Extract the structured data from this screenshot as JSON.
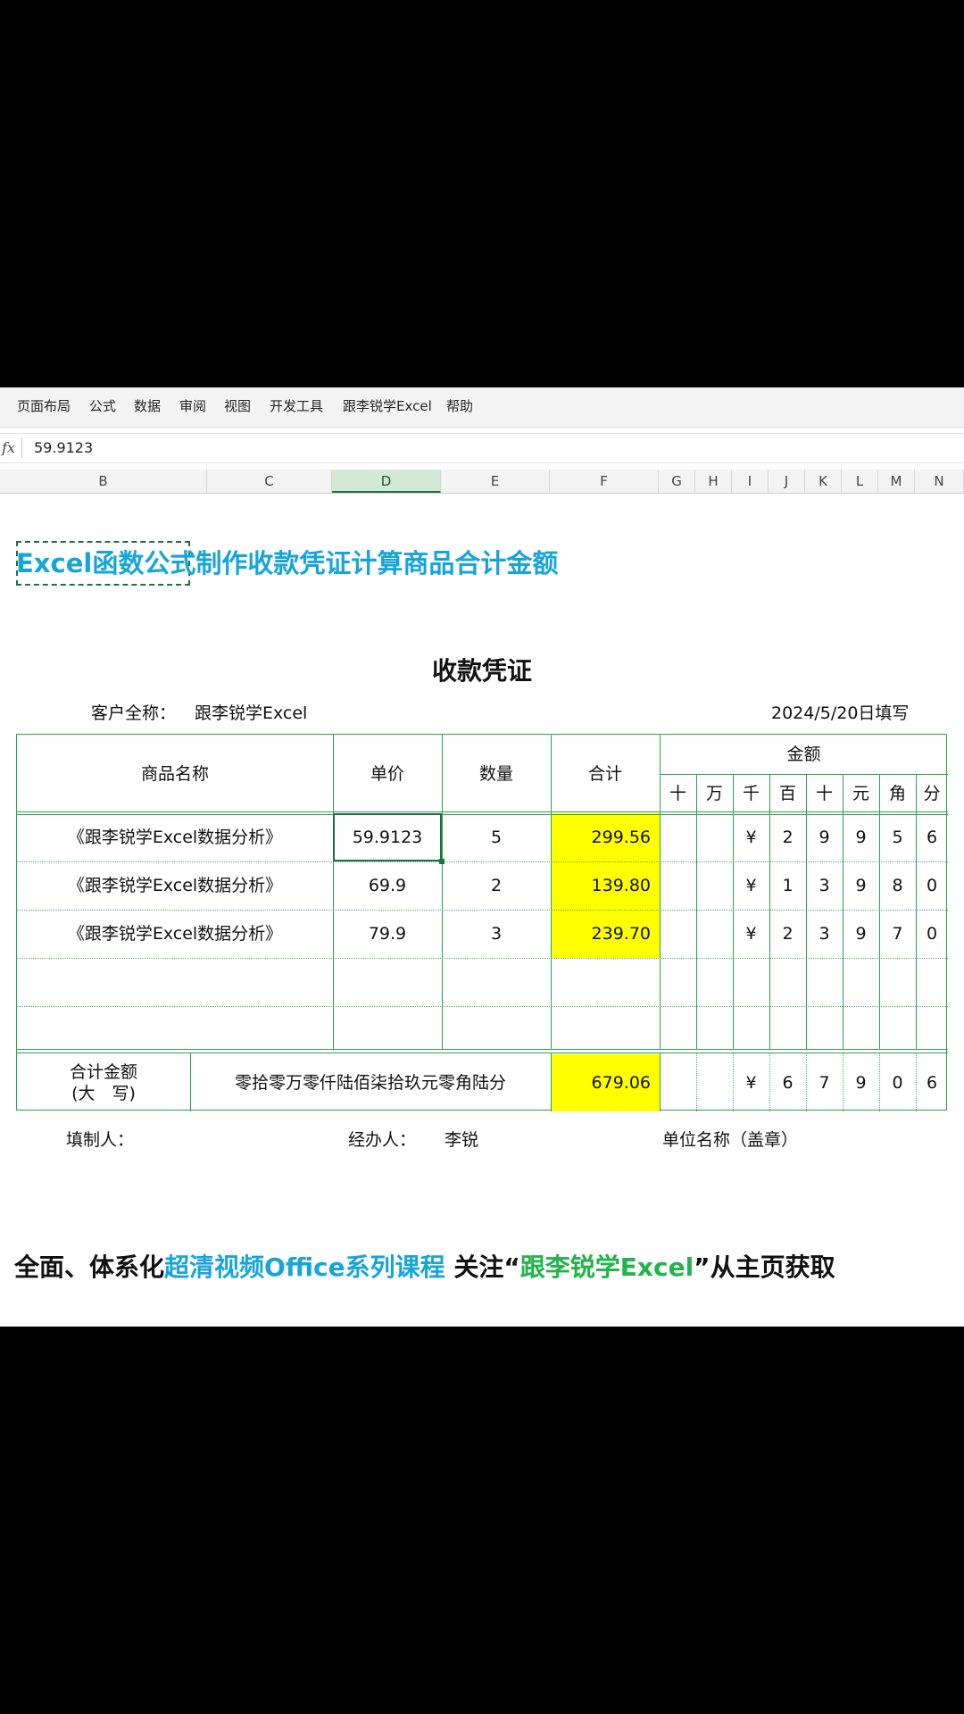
{
  "ribbon": {
    "tabs": [
      "页面布局",
      "公式",
      "数据",
      "审阅",
      "视图",
      "开发工具",
      "跟李锐学Excel",
      "帮助"
    ]
  },
  "formula_bar": {
    "fx_label": "fx",
    "value": "59.9123"
  },
  "columns": [
    "B",
    "C",
    "D",
    "E",
    "F",
    "G",
    "H",
    "I",
    "J",
    "K",
    "L",
    "M",
    "N"
  ],
  "active_column": "D",
  "sheet_title": "Excel函数公式制作收款凭证计算商品合计金额",
  "voucher": {
    "title": "收款凭证",
    "customer_label": "客户全称：",
    "customer_name": "跟李锐学Excel",
    "date": "2024/5/20日填写",
    "headers": {
      "product": "商品名称",
      "price": "单价",
      "qty": "数量",
      "subtotal": "合计",
      "amount": "金额",
      "digits": [
        "十",
        "万",
        "千",
        "百",
        "十",
        "元",
        "角",
        "分"
      ]
    },
    "rows": [
      {
        "product": "《跟李锐学Excel数据分析》",
        "price": "59.9123",
        "qty": "5",
        "subtotal": "299.56",
        "digits": [
          "",
          "",
          "¥",
          "2",
          "9",
          "9",
          "5",
          "6"
        ]
      },
      {
        "product": "《跟李锐学Excel数据分析》",
        "price": "69.9",
        "qty": "2",
        "subtotal": "139.80",
        "digits": [
          "",
          "",
          "¥",
          "1",
          "3",
          "9",
          "8",
          "0"
        ]
      },
      {
        "product": "《跟李锐学Excel数据分析》",
        "price": "79.9",
        "qty": "3",
        "subtotal": "239.70",
        "digits": [
          "",
          "",
          "¥",
          "2",
          "3",
          "9",
          "7",
          "0"
        ]
      },
      {
        "product": "",
        "price": "",
        "qty": "",
        "subtotal": "",
        "digits": [
          "",
          "",
          "",
          "",
          "",
          "",
          "",
          ""
        ]
      },
      {
        "product": "",
        "price": "",
        "qty": "",
        "subtotal": "",
        "digits": [
          "",
          "",
          "",
          "",
          "",
          "",
          "",
          ""
        ]
      }
    ],
    "total": {
      "label_line1": "合计金额",
      "label_line2": "(大　写)",
      "in_words": "零拾零万零仟陆佰柒拾玖元零角陆分",
      "value": "679.06",
      "digits": [
        "",
        "",
        "¥",
        "6",
        "7",
        "9",
        "0",
        "6"
      ]
    },
    "footer": {
      "preparer": "填制人：",
      "handler_label": "经办人：",
      "handler_name": "李锐",
      "unit": "单位名称（盖章）"
    }
  },
  "promo": {
    "part1": "全面、体系化",
    "part2": "超清视频Office系列课程",
    "part3": "  关注“",
    "part4": "跟李锐学Excel",
    "part5": "”从主页获取"
  }
}
